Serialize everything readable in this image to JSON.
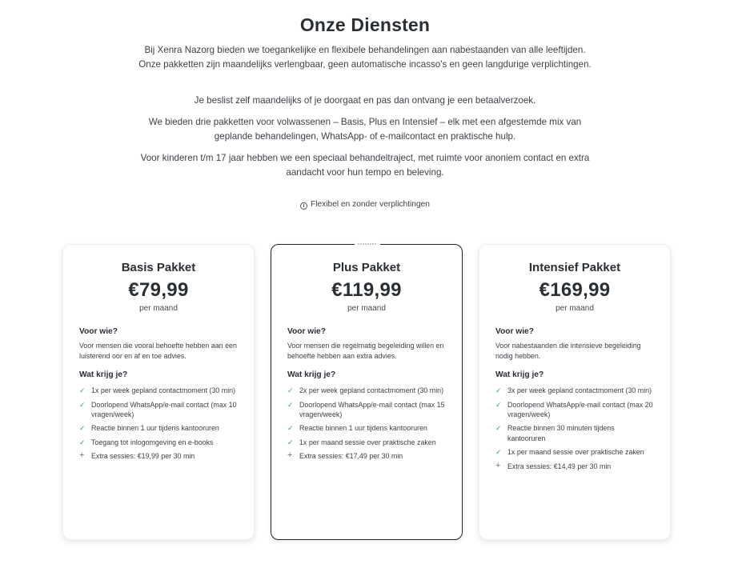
{
  "header": {
    "title": "Onze Diensten",
    "paragraphs": [
      "Bij Xenra Nazorg bieden we toegankelijke en flexibele behandelingen aan nabestaanden van alle leeftijden. Onze pakketten zijn maandelijks verlengbaar, geen automatische incasso's en geen langdurige verplichtingen.",
      "Je beslist zelf maandelijks of je doorgaat en pas dan ontvang je een betaalverzoek.",
      "We bieden drie pakketten voor volwassenen – Basis, Plus en Intensief – elk met een afgestemde mix van geplande behandelingen, WhatsApp- of e-mailcontact en praktische hulp.",
      "Voor kinderen t/m 17 jaar hebben we een speciaal behandeltraject, met ruimte voor anoniem contact en extra aandacht voor hun tempo en beleving."
    ],
    "flex_note": "Flexibel en zonder verplichtingen"
  },
  "labels": {
    "who": "Voor wie?",
    "gets": "Wat krijg je?",
    "per_month": "per maand"
  },
  "packages": [
    {
      "name": "Basis Pakket",
      "price": "€79,99",
      "who": "Voor mensen die vooral behoefte hebben aan een luisterend oor en af en toe advies.",
      "features": [
        "1x per week gepland contactmoment (30 min)",
        "Doorlopend WhatsApp/e-mail contact (max 10 vragen/week)",
        "Reactie binnen 1 uur tijdens kantooruren",
        "Toegang tot inlogomgeving en e-books"
      ],
      "extra": "Extra sessies: €19,99 per 30 min"
    },
    {
      "name": "Plus Pakket",
      "price": "€119,99",
      "who": "Voor mensen die regelmatig begeleiding willen en behoefte hebben aan extra advies.",
      "features": [
        "2x per week gepland contactmoment (30 min)",
        "Doorlopend WhatsApp/e-mail contact (max 15 vragen/week)",
        "Reactie binnen 1 uur tijdens kantooruren",
        "1x per maand sessie over praktische zaken"
      ],
      "extra": "Extra sessies: €17,49 per 30 min"
    },
    {
      "name": "Intensief Pakket",
      "price": "€169,99",
      "who": "Voor nabestaanden die intensieve begeleiding nodig hebben.",
      "features": [
        "3x per week gepland contactmoment (30 min)",
        "Doorlopend WhatsApp/e-mail contact (max 20 vragen/week)",
        "Reactie binnen 30 minuten tijdens kantooruren",
        "1x per maand sessie over praktische zaken"
      ],
      "extra": "Extra sessies: €14,49 per 30 min"
    }
  ],
  "icons": {
    "check": "check-icon",
    "plus": "plus-icon",
    "info": "info-icon"
  },
  "colors": {
    "check_green": "#34a853",
    "text_dark": "#2a2f36",
    "highlight_border": "#1f2328"
  }
}
